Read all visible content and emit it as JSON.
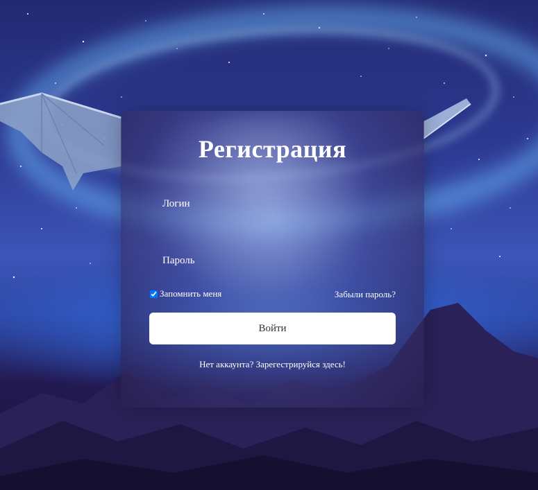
{
  "form": {
    "title": "Регистрация",
    "login_placeholder": "Логин",
    "password_placeholder": "Пароль",
    "remember_label": "Запомнить меня",
    "remember_checked": true,
    "forgot_link": "Забыли пароль?",
    "submit_label": "Войти",
    "register_text": "Нет аккаунта? Зарегестрируйся здесь!"
  },
  "colors": {
    "button_bg": "#ffffff",
    "text": "#ffffff",
    "sky": "#2d3a92",
    "glow": "#6ebeff"
  }
}
